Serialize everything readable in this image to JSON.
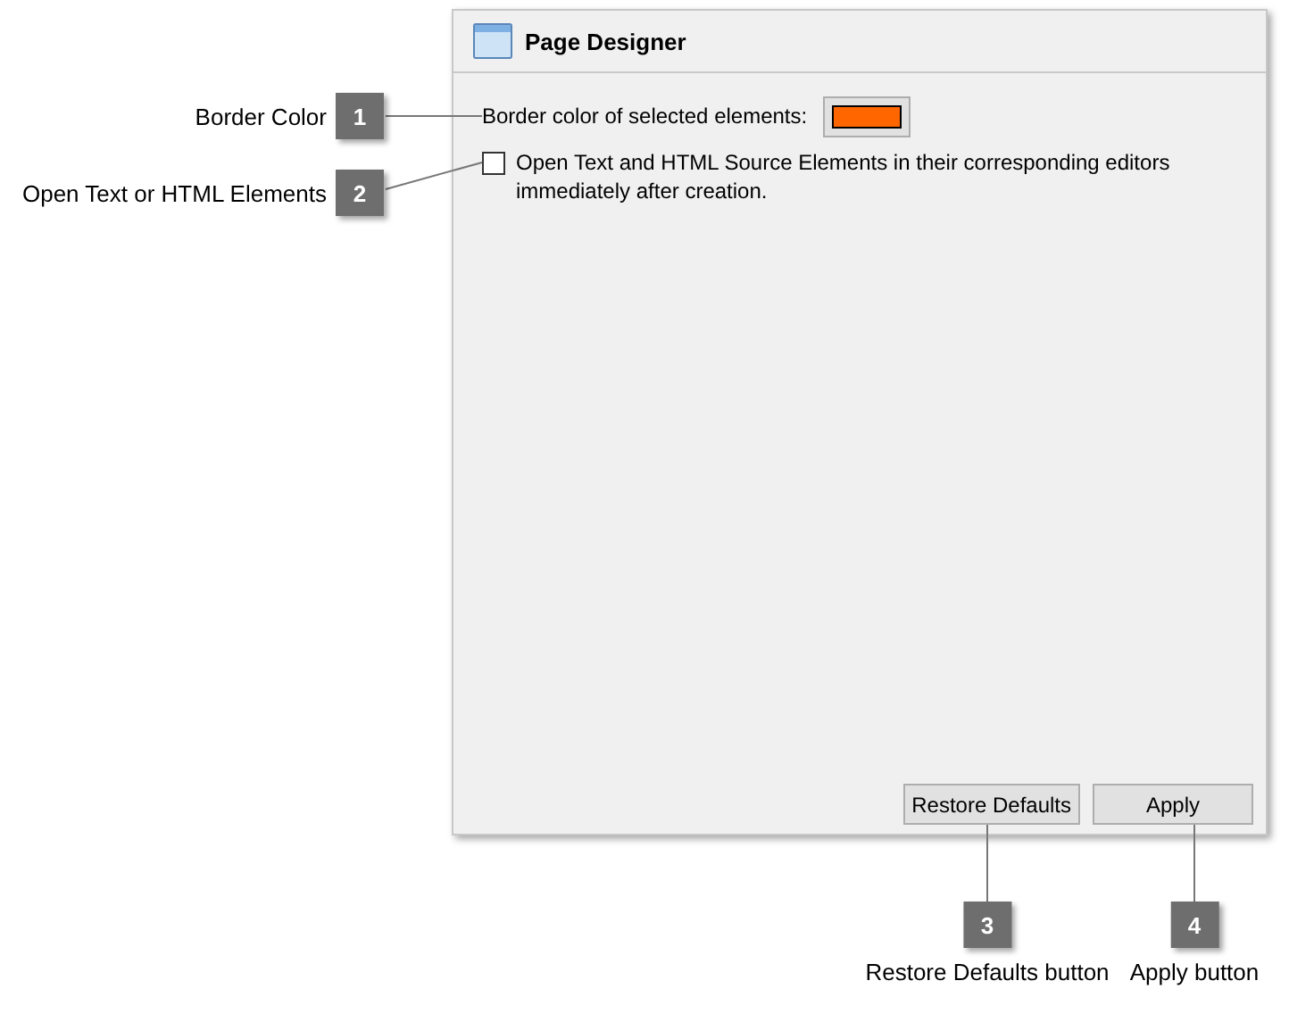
{
  "panel": {
    "title": "Page Designer",
    "border_color_label": "Border color of selected elements:",
    "border_color_swatch": {
      "color": "#ff6600"
    },
    "open_in_editors": {
      "label": "Open Text and HTML Source Elements in their corresponding editors immediately after creation.",
      "checked": false
    },
    "buttons": [
      "Restore Defaults",
      "Apply"
    ]
  },
  "callouts": [
    {
      "number": "1",
      "label": "Border Color"
    },
    {
      "number": "2",
      "label": "Open Text or HTML Elements"
    },
    {
      "number": "3",
      "label": "Restore Defaults button"
    },
    {
      "number": "4",
      "label": "Apply button"
    }
  ]
}
